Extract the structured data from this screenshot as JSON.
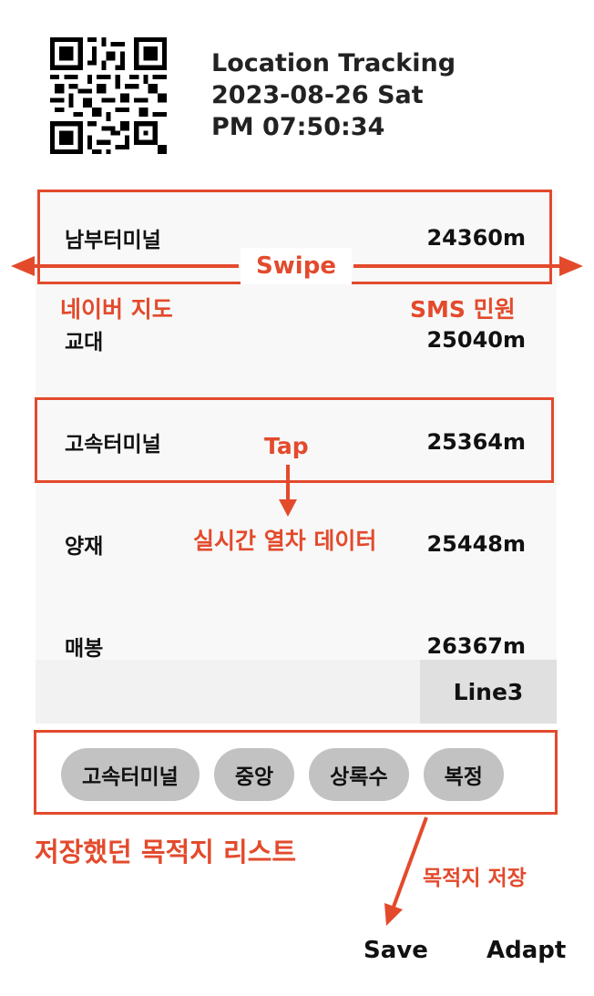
{
  "header": {
    "title": "Location Tracking",
    "date": "2023-08-26 Sat",
    "time": "PM 07:50:34"
  },
  "stations": [
    {
      "name": "남부터미널",
      "distance": "24360m"
    },
    {
      "name": "교대",
      "distance": "25040m"
    },
    {
      "name": "고속터미널",
      "distance": "25364m"
    },
    {
      "name": "양재",
      "distance": "25448m"
    },
    {
      "name": "매봉",
      "distance": "26367m"
    }
  ],
  "line_badge": "Line3",
  "saved_destinations": [
    "고속터미널",
    "중앙",
    "상록수",
    "복정"
  ],
  "buttons": {
    "save": "Save",
    "adapt": "Adapt"
  },
  "annotations": {
    "swipe": "Swipe",
    "left_action": "네이버 지도",
    "right_action": "SMS 민원",
    "tap": "Tap",
    "tap_result": "실시간 열차 데이터",
    "saved_list": "저장했던 목적지 리스트",
    "save_destination": "목적지 저장"
  },
  "colors": {
    "annotation": "#e34a2c",
    "chip": "#c2c2c2",
    "list_bg": "#f8f8f8",
    "badge": "#e0e0e0"
  }
}
